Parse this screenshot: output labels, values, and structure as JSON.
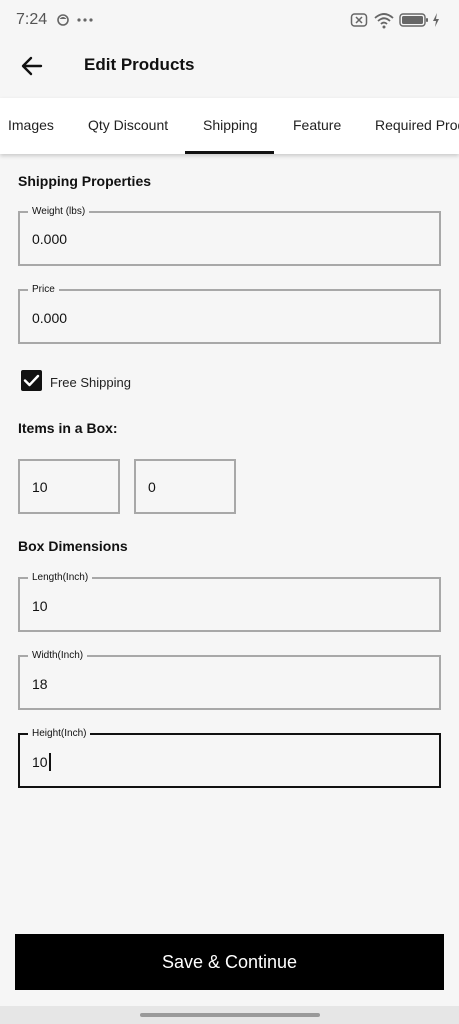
{
  "status": {
    "time": "7:24",
    "left_icons": [
      "face-icon",
      "more-dots-icon"
    ],
    "right_icons": [
      "sim-off-icon",
      "wifi-icon",
      "battery-icon",
      "charging-icon"
    ]
  },
  "header": {
    "title": "Edit Products",
    "back_icon": "back-arrow-icon"
  },
  "tabs": [
    {
      "label": "Images",
      "selected": false
    },
    {
      "label": "Qty Discount",
      "selected": false
    },
    {
      "label": "Shipping",
      "selected": true
    },
    {
      "label": "Feature",
      "selected": false
    },
    {
      "label": "Required Prod",
      "selected": false
    }
  ],
  "shipping": {
    "section_title": "Shipping Properties",
    "weight": {
      "label": "Weight (lbs)",
      "value": "0.000"
    },
    "price": {
      "label": "Price",
      "value": "0.000"
    },
    "free_shipping": {
      "label": "Free Shipping",
      "checked": true
    }
  },
  "items_box": {
    "title": "Items in a Box:",
    "values": [
      "10",
      "0"
    ]
  },
  "dimensions": {
    "title": "Box Dimensions",
    "length": {
      "label": "Length(Inch)",
      "value": "10"
    },
    "width": {
      "label": "Width(Inch)",
      "value": "18"
    },
    "height": {
      "label": "Height(Inch)",
      "value": "10"
    }
  },
  "actions": {
    "save_label": "Save & Continue"
  },
  "colors": {
    "primary": "#000000",
    "background": "#f6f6f6",
    "field_border": "#a8a8a8"
  }
}
